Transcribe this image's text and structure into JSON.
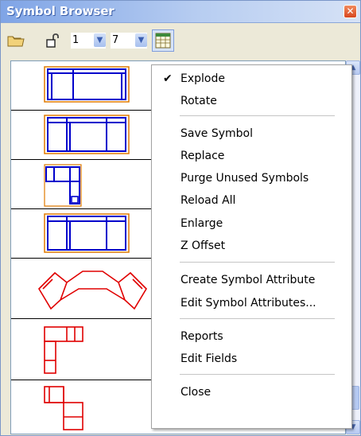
{
  "window": {
    "title": "Symbol Browser",
    "close_glyph": "✕"
  },
  "toolbar": {
    "folder_icon": "folder-icon",
    "lock_icon": "unlock-icon",
    "combo1_value": "1",
    "combo2_value": "7",
    "arrow_glyph": "▼",
    "grid_icon": "calendar-grid-icon"
  },
  "symbols": [
    {
      "id": "sofa-blue-1",
      "color": "#0000cc"
    },
    {
      "id": "sofa-blue-2",
      "color": "#0000cc"
    },
    {
      "id": "chair-blue-l",
      "color": "#0000cc"
    },
    {
      "id": "sofa-blue-3",
      "color": "#0000cc"
    },
    {
      "id": "sectional-red-curved",
      "color": "#e00000"
    },
    {
      "id": "sectional-red-l",
      "color": "#e00000"
    },
    {
      "id": "sectional-red-l2",
      "color": "#e00000"
    }
  ],
  "context_menu": {
    "check_glyph": "✔",
    "items": [
      {
        "label": "Explode",
        "checked": true
      },
      {
        "label": "Rotate"
      },
      {
        "label": "Save Symbol"
      },
      {
        "label": "Replace"
      },
      {
        "label": "Purge Unused Symbols"
      },
      {
        "label": "Reload All"
      },
      {
        "label": "Enlarge"
      },
      {
        "label": "Z Offset"
      },
      {
        "label": "Create Symbol Attribute"
      },
      {
        "label": "Edit Symbol Attributes..."
      },
      {
        "label": "Reports"
      },
      {
        "label": "Edit Fields"
      },
      {
        "label": "Close"
      }
    ]
  },
  "scrollbar": {
    "up_glyph": "▲",
    "down_glyph": "▼"
  }
}
